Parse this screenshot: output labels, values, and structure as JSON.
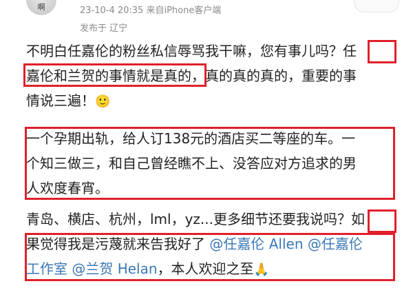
{
  "header": {
    "avatar_char": "啊",
    "timestamp": "23-10-4 20:35",
    "source": "来自iPhone客户端",
    "location": "发布于 辽宁"
  },
  "post": {
    "p1": {
      "l1_text": "不明白任嘉伦的粉丝私信辱骂我干嘛，您有事儿吗？",
      "l1_mark": "任",
      "l2_mark": "嘉伦和兰贺的事情就是真的",
      "l2_text": "，真的真的真的，重要的事",
      "l3_text": "情说三遍！",
      "l3_emoji": "🙂"
    },
    "p2": {
      "l1": "一个孕期出轨，给人订138元的酒店买二等座的车。一",
      "l2": "个知三做三，和自己曾经瞧不上、没答应对方追求的男",
      "l3": "人欢度春宵。"
    },
    "p3": {
      "l1_text": "青岛、横店、杭州，lml，yz...更多细节还要我说吗？",
      "l1_mark": "如",
      "l2_text": "果觉得我是污蔑就来告我好了",
      "l2_m1": "@任嘉伦 Allen",
      "l2_m2": "@任嘉伦",
      "l3_m1": "工作室",
      "l3_m2": "@兰贺 Helan",
      "l3_text": "，本人欢迎之至",
      "l3_emoji": "🙏"
    }
  }
}
